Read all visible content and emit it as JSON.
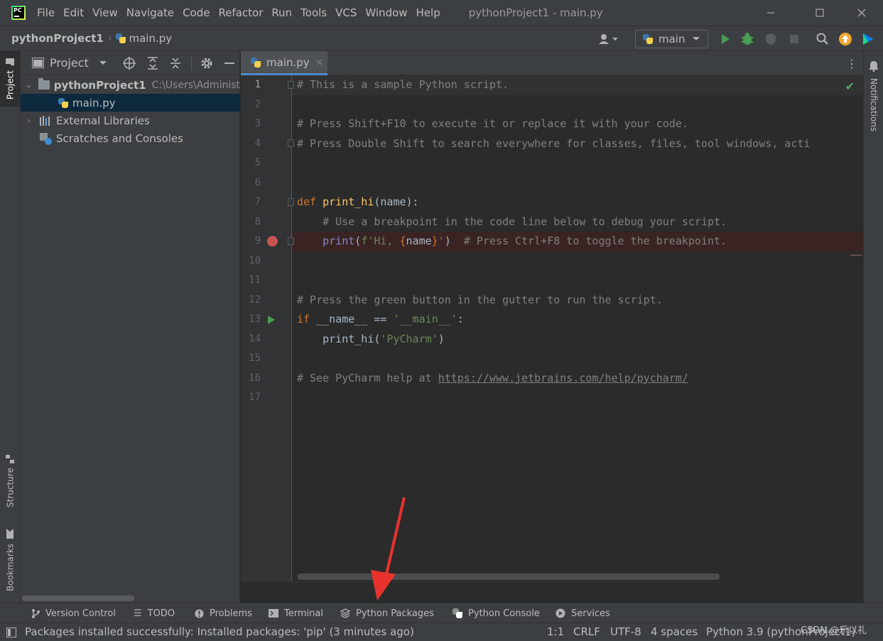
{
  "menu": {
    "items": [
      "File",
      "Edit",
      "View",
      "Navigate",
      "Code",
      "Refactor",
      "Run",
      "Tools",
      "VCS",
      "Window",
      "Help"
    ],
    "window_title": "pythonProject1 - main.py"
  },
  "navbar": {
    "project": "pythonProject1",
    "file": "main.py",
    "run_config": "main"
  },
  "left_stripe": {
    "project": "Project",
    "structure": "Structure",
    "bookmarks": "Bookmarks"
  },
  "project_panel": {
    "title": "Project",
    "tree": [
      {
        "label": "pythonProject1",
        "hint": "C:\\Users\\Administ"
      },
      {
        "label": "main.py"
      },
      {
        "label": "External Libraries"
      },
      {
        "label": "Scratches and Consoles"
      }
    ]
  },
  "editor": {
    "tab_label": "main.py",
    "line_numbers": [
      "1",
      "2",
      "3",
      "4",
      "5",
      "6",
      "7",
      "8",
      "9",
      "10",
      "11",
      "12",
      "13",
      "14",
      "15",
      "16",
      "17"
    ],
    "lines": {
      "l1": "# This is a sample Python script.",
      "l3": "# Press Shift+F10 to execute it or replace it with your code.",
      "l4": "# Press Double Shift to search everywhere for classes, files, tool windows, acti",
      "l7_kw": "def",
      "l7_fn": "print_hi",
      "l7_rest": "(name):",
      "l8": "    # Use a breakpoint in the code line below to debug your script.",
      "l9_indent": "    ",
      "l9_builtin": "print",
      "l9_open": "(",
      "l9_str1": "f'Hi, ",
      "l9_brace_open": "{",
      "l9_name": "name",
      "l9_brace_close": "}",
      "l9_str2": "'",
      "l9_close": ")  ",
      "l9_cmt": "# Press Ctrl+F8 to toggle the breakpoint.",
      "l12": "# Press the green button in the gutter to run the script.",
      "l13_kw": "if",
      "l13_mid": " __name__ == ",
      "l13_str": "'__main__'",
      "l13_end": ":",
      "l14_pre": "    print_hi(",
      "l14_str": "'PyCharm'",
      "l14_end": ")",
      "l16_pre": "# See PyCharm help at ",
      "l16_link": "https://www.jetbrains.com/help/pycharm/"
    }
  },
  "right_stripe": {
    "notifications": "Notifications"
  },
  "tool_windows": [
    "Version Control",
    "TODO",
    "Problems",
    "Terminal",
    "Python Packages",
    "Python Console",
    "Services"
  ],
  "status": {
    "message": "Packages installed successfully: Installed packages: 'pip' (3 minutes ago)",
    "position": "1:1",
    "line_sep": "CRLF",
    "encoding": "UTF-8",
    "indent": "4 spaces",
    "interpreter": "Python 3.9 (pythonProject1)"
  },
  "watermark": "CSDN @乐以礼",
  "colors": {
    "accent": "#4a88c7",
    "run_green": "#499c54",
    "breakpoint_red": "#c75450",
    "annotation_red": "#e8322d"
  }
}
